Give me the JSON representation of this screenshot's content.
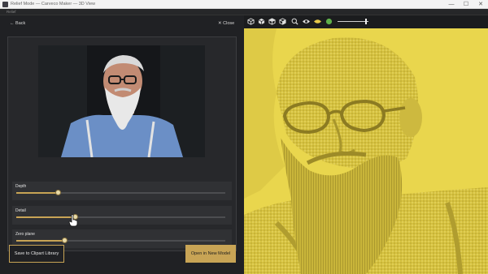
{
  "window": {
    "title": "Relief Mode — Carveco Maker — 3D View",
    "controls": {
      "minimize": "—",
      "maximize": "☐",
      "close": "✕"
    }
  },
  "menubar": {
    "item": "Relief"
  },
  "nav": {
    "back_label": "Back",
    "close_label": "Close"
  },
  "sliders": [
    {
      "label": "Depth",
      "value": 0.2
    },
    {
      "label": "Detail",
      "value": 0.28
    },
    {
      "label": "Zero plane",
      "value": 0.23
    }
  ],
  "buttons": {
    "save": "Save to Clipart Library",
    "open": "Open in New Model"
  },
  "toolbar": {
    "icons": [
      "cube-iso-icon",
      "cube-front-icon",
      "cube-top-icon",
      "cube-side-icon",
      "zoom-fit-icon",
      "render-mode-icon",
      "material-gold-icon",
      "material-green-icon"
    ],
    "slider_value": 0.9
  },
  "colors": {
    "accent": "#c8a455",
    "relief": "#e6d24a",
    "panel": "#27282b"
  }
}
